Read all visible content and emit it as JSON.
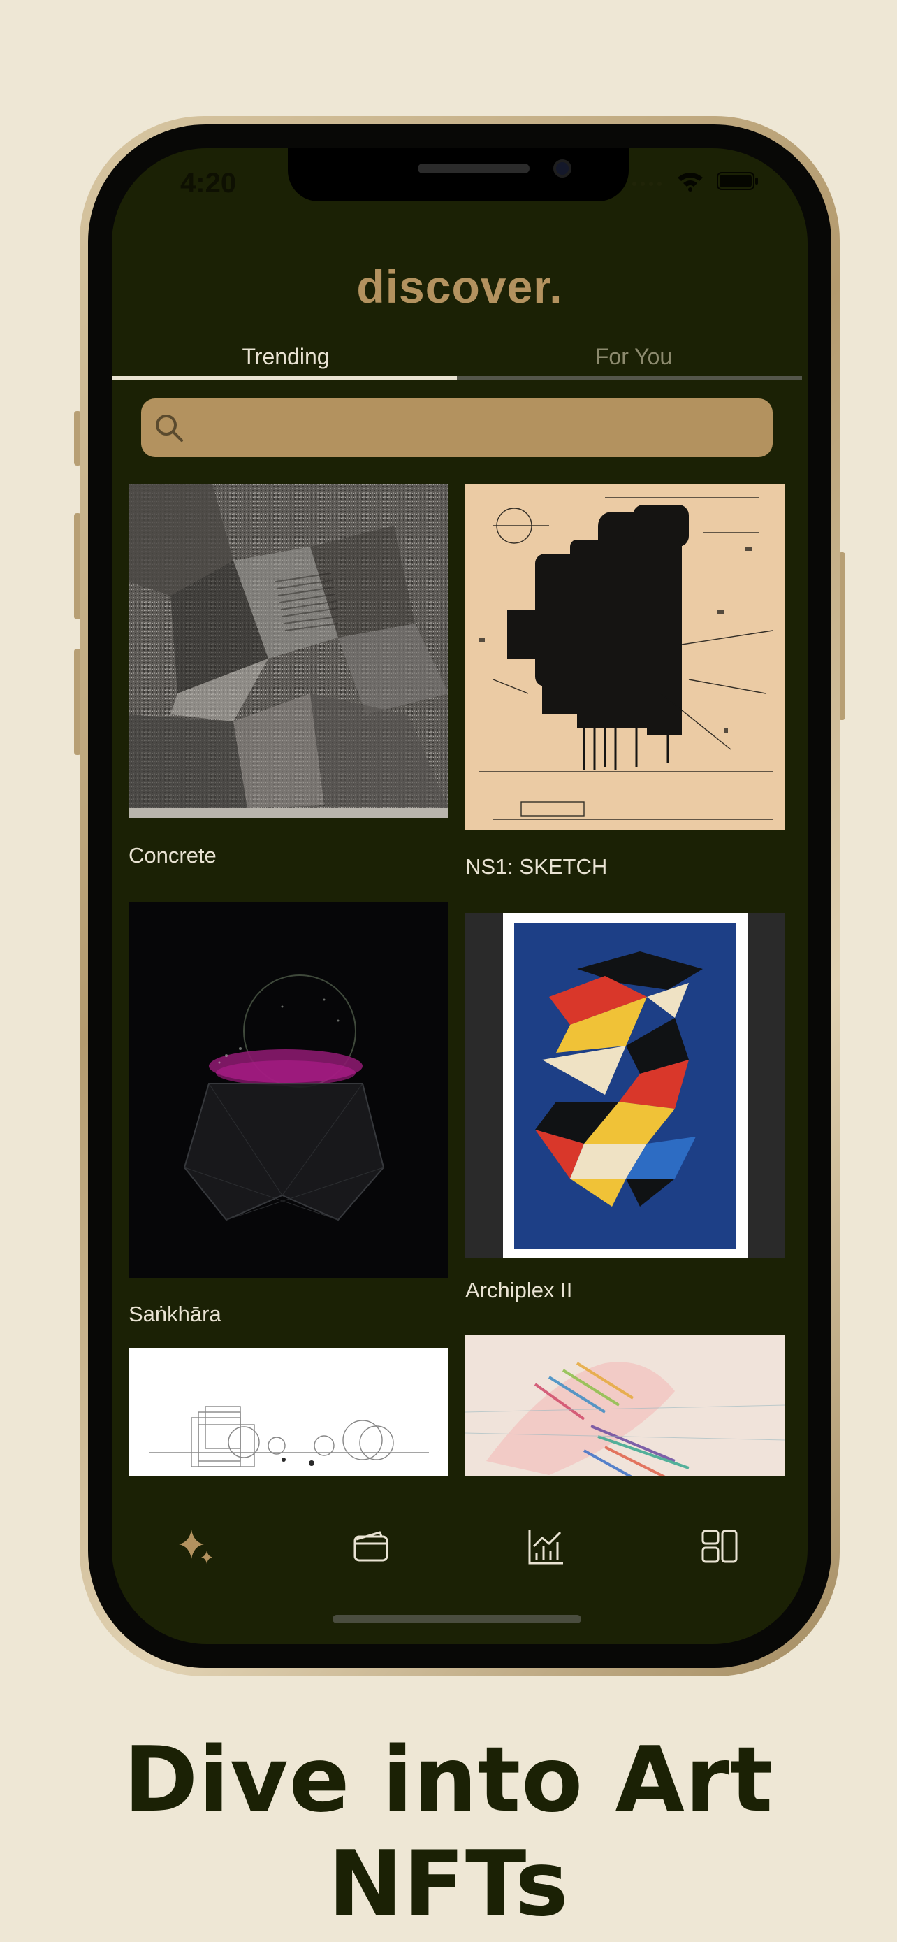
{
  "status_bar": {
    "time": "4:20"
  },
  "header": {
    "title": "discover."
  },
  "tabs": [
    {
      "label": "Trending",
      "active": true
    },
    {
      "label": "For You",
      "active": false
    }
  ],
  "search": {
    "placeholder": "",
    "icon": "search-icon"
  },
  "artworks": [
    {
      "title": "Concrete"
    },
    {
      "title": "NS1: SKETCH"
    },
    {
      "title": "Saṅkhāra"
    },
    {
      "title": "Archiplex II"
    },
    {
      "title": ""
    },
    {
      "title": ""
    }
  ],
  "bottom_nav": [
    {
      "icon": "sparkle-icon",
      "active": true
    },
    {
      "icon": "wallet-icon",
      "active": false
    },
    {
      "icon": "chart-icon",
      "active": false
    },
    {
      "icon": "dashboard-icon",
      "active": false
    }
  ],
  "tagline": "Dive into Art NFTs",
  "colors": {
    "background": "#EEE7D5",
    "screen": "#1B2105",
    "accent": "#B3925F",
    "text_light": "#E9E3D3",
    "text_dark": "#1B2105"
  }
}
